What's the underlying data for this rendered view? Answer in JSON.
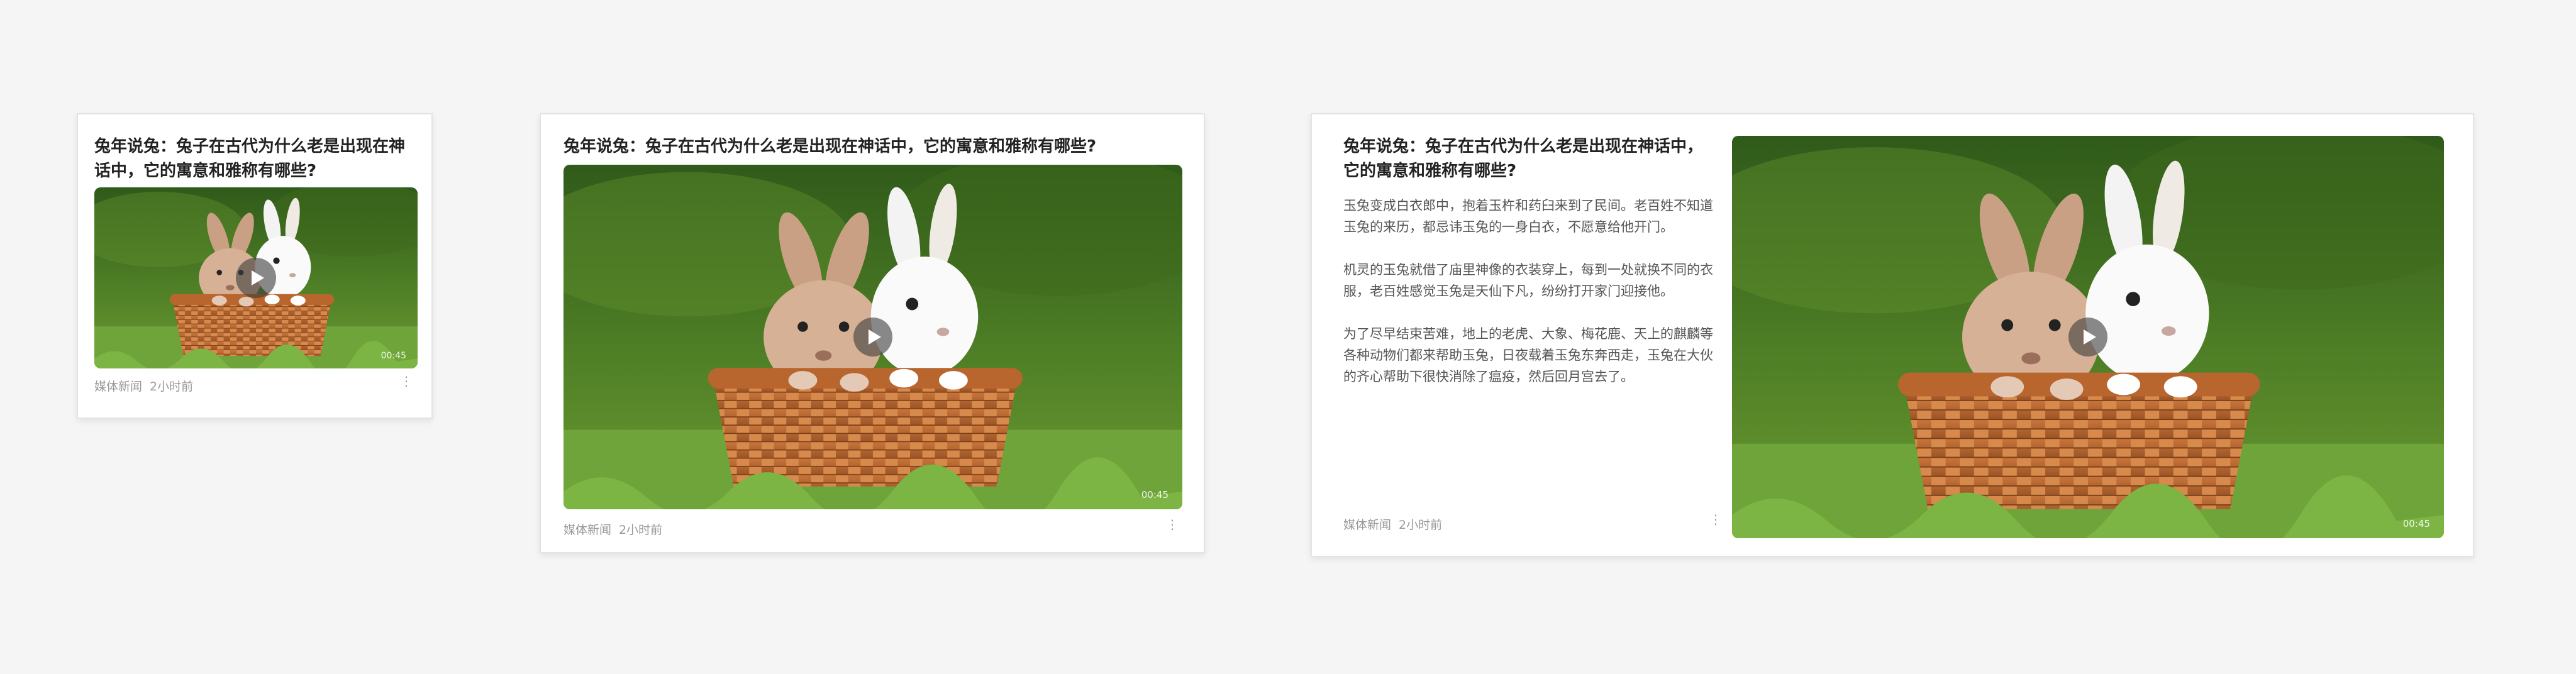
{
  "article": {
    "title": "兔年说兔：兔子在古代为什么老是出现在神话中，它的寓意和雅称有哪些?",
    "source": "媒体新闻",
    "time": "2小时前",
    "duration": "00:45",
    "play_icon": "play-icon",
    "more_icon": "more-vertical-icon",
    "paragraphs": [
      "玉兔变成白衣郎中，抱着玉杵和药臼来到了民间。老百姓不知道玉兔的来历，都忌讳玉兔的一身白衣，不愿意给他开门。",
      "机灵的玉兔就借了庙里神像的衣装穿上，每到一处就换不同的衣服，老百姓感觉玉兔是天仙下凡，纷纷打开家门迎接他。",
      "为了尽早结束苦难，地上的老虎、大象、梅花鹿、天上的麒麟等各种动物们都来帮助玉兔，日夜载着玉兔东奔西走，玉兔在大伙的齐心帮助下很快消除了瘟疫，然后回月宫去了。"
    ]
  },
  "colors": {
    "background": "#f5f5f5",
    "card": "#ffffff",
    "title": "#222222",
    "meta": "#999999"
  }
}
